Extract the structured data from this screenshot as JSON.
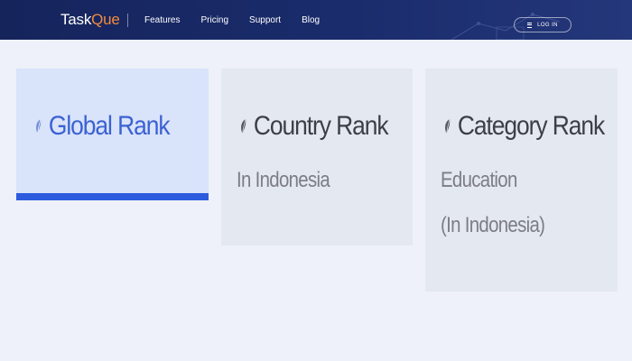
{
  "header": {
    "logo": {
      "text_main": "Task",
      "text_accent": "Que"
    },
    "nav": [
      {
        "label": "Features"
      },
      {
        "label": "Pricing"
      },
      {
        "label": "Support"
      },
      {
        "label": "Blog"
      }
    ],
    "login_label": "LOG IN"
  },
  "cards": [
    {
      "title": "Global Rank",
      "subtitle_lines": [],
      "active": true
    },
    {
      "title": "Country Rank",
      "subtitle_lines": [
        "In Indonesia"
      ],
      "active": false
    },
    {
      "title": "Category Rank",
      "subtitle_lines": [
        "Education",
        "(In Indonesia)"
      ],
      "active": false
    }
  ],
  "colors": {
    "header_bg": "#1a2c6c",
    "accent_orange": "#f08a3c",
    "active_blue": "#3b62d2",
    "active_bar": "#2d5bde",
    "page_bg": "#eef1f9"
  }
}
